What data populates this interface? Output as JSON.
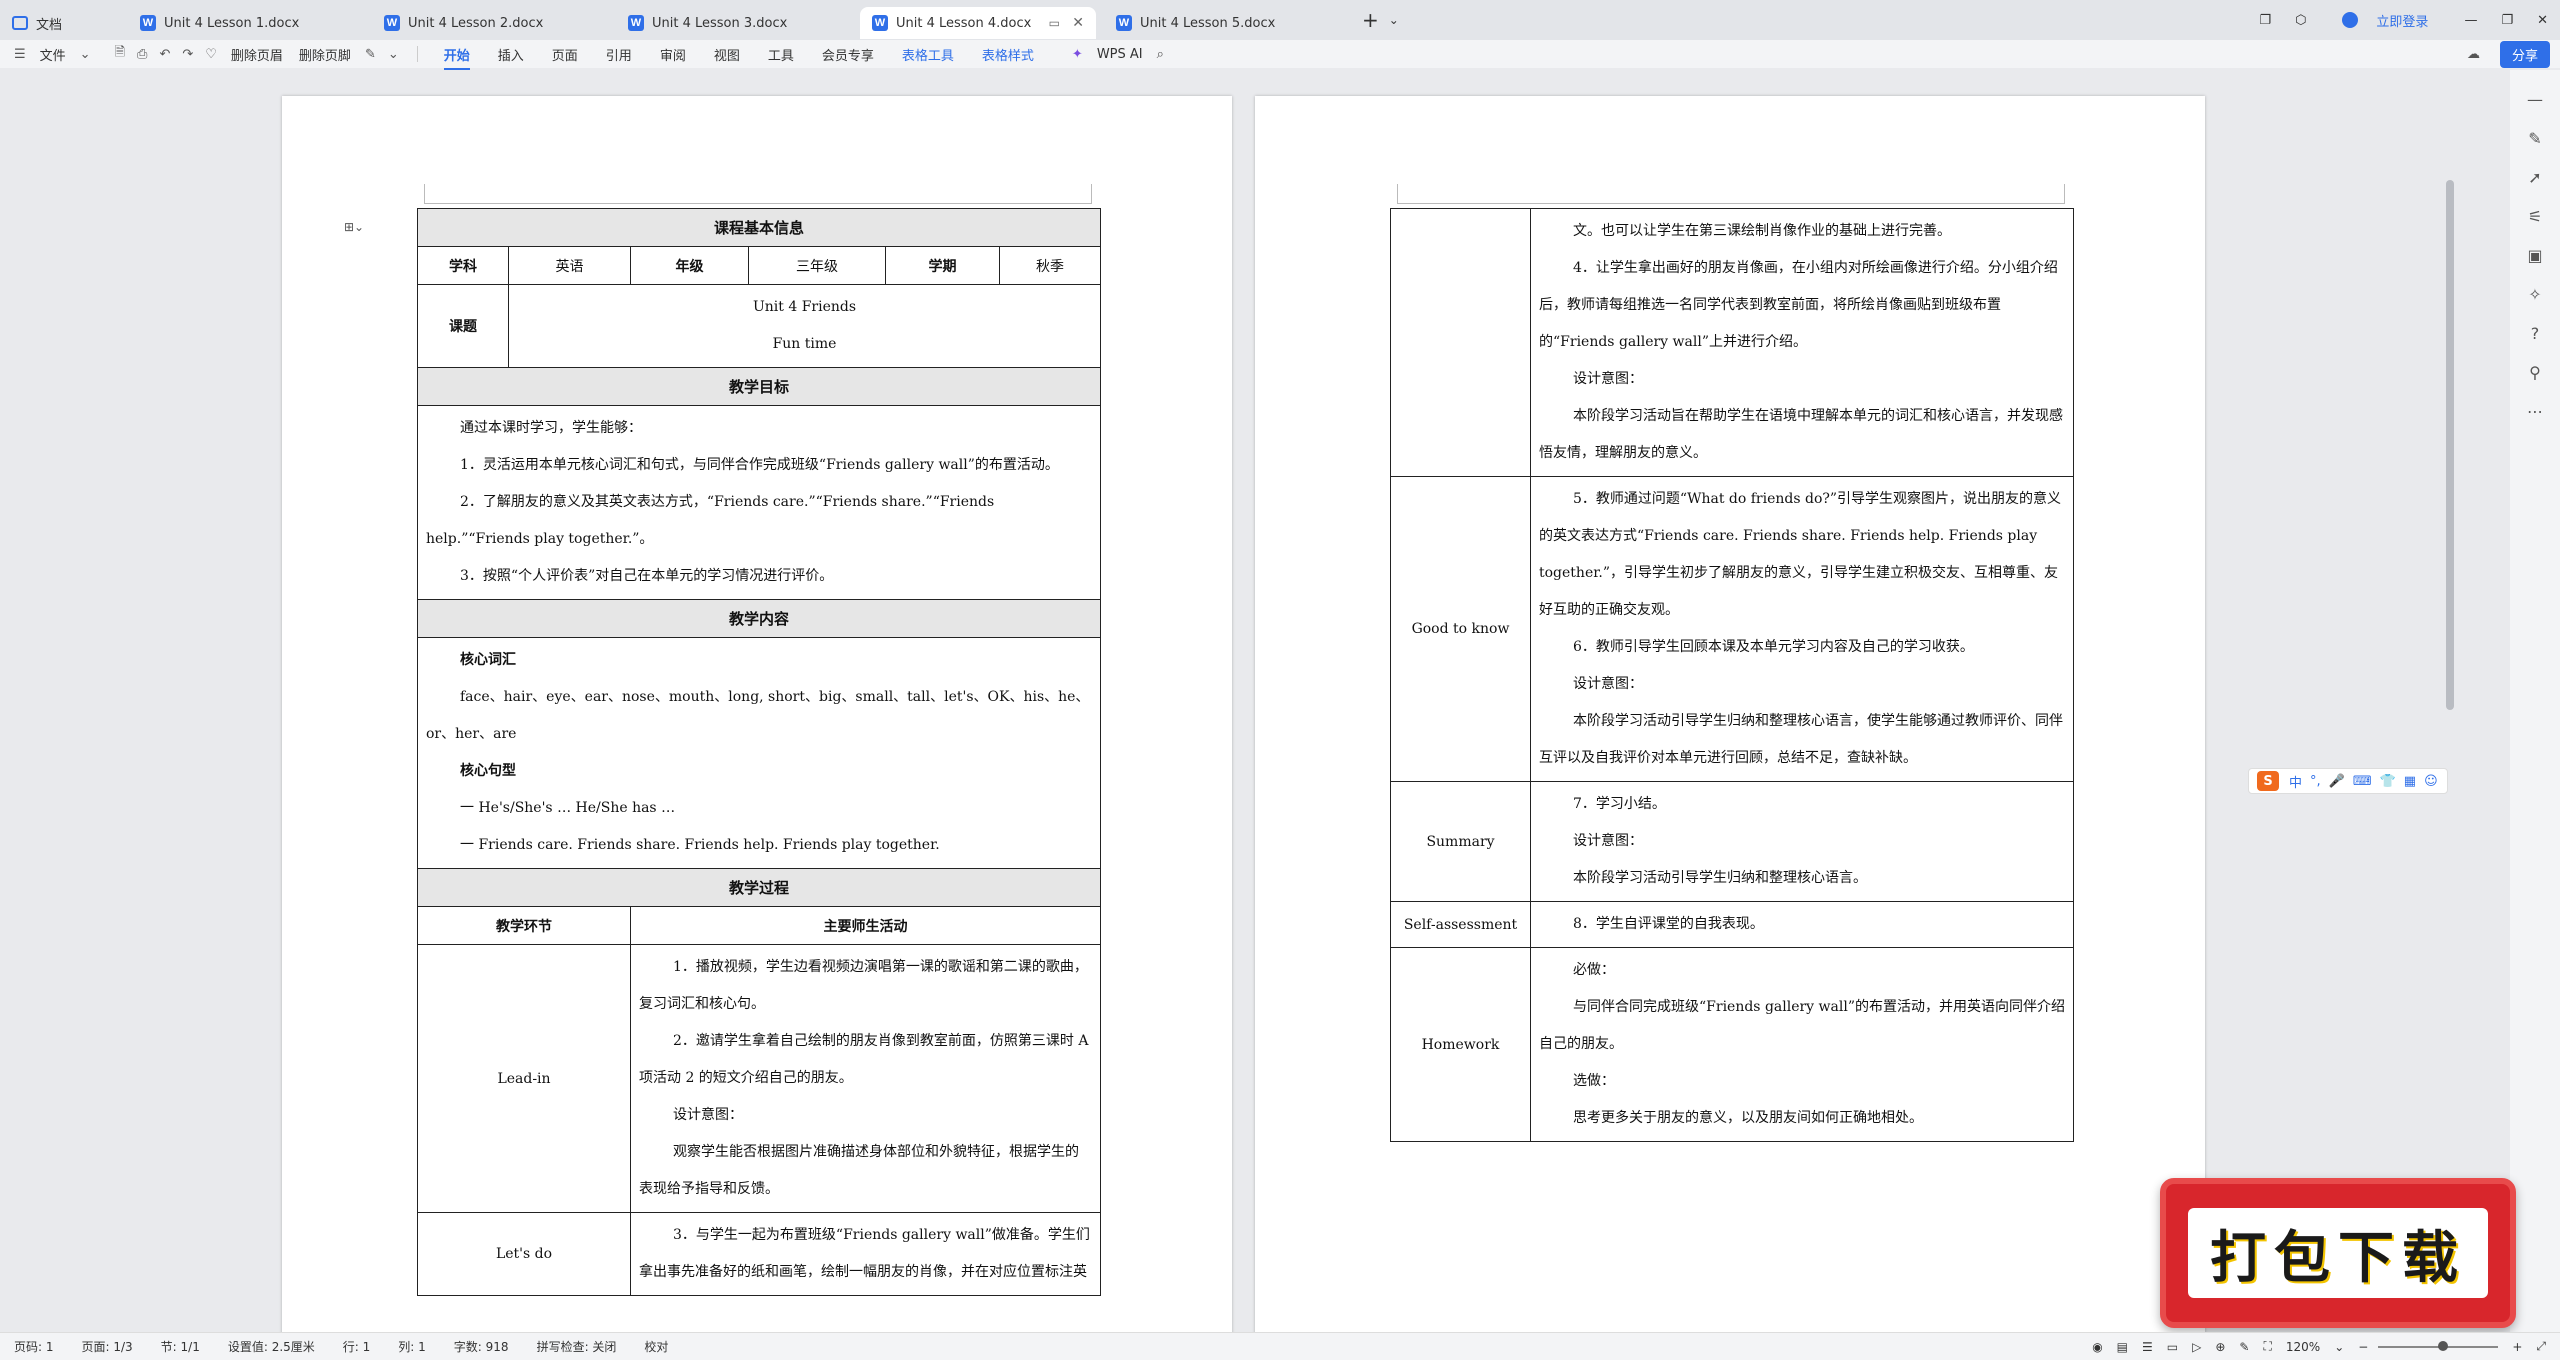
{
  "tabs": [
    {
      "label": "文档",
      "type": "home"
    },
    {
      "label": "Unit 4 Lesson 1.docx",
      "type": "doc"
    },
    {
      "label": "Unit 4 Lesson 2.docx",
      "type": "doc"
    },
    {
      "label": "Unit 4 Lesson 3.docx",
      "type": "doc"
    },
    {
      "label": "Unit 4 Lesson 4.docx",
      "type": "doc",
      "active": true
    },
    {
      "label": "Unit 4 Lesson 5.docx",
      "type": "doc"
    }
  ],
  "titlebar": {
    "login": "立即登录",
    "new_tab": "+",
    "tab_menu": "⌄"
  },
  "ribbon": {
    "file": "文件",
    "delete_header": "删除页眉",
    "delete_footer": "删除页脚",
    "menus": [
      "开始",
      "插入",
      "页面",
      "引用",
      "审阅",
      "视图",
      "工具",
      "会员专享",
      "表格工具",
      "表格样式"
    ],
    "active_menu": "开始",
    "wps_ai": "WPS AI",
    "share": "分享"
  },
  "page1": {
    "title": "课程基本信息",
    "subject_label": "学科",
    "subject": "英语",
    "grade_label": "年级",
    "grade": "三年级",
    "term_label": "学期",
    "term": "秋季",
    "topic_label": "课题",
    "topic_line1": "Unit 4 Friends",
    "topic_line2": "Fun time",
    "goals_title": "教学目标",
    "goals": [
      "通过本课时学习，学生能够：",
      "1．灵活运用本单元核心词汇和句式，与同伴合作完成班级“Friends gallery wall”的布置活动。",
      "2．了解朋友的意义及其英文表达方式，“Friends care.”“Friends share.”“Friends help.”“Friends play together.”。",
      "3．按照“个人评价表”对自己在本单元的学习情况进行评价。"
    ],
    "content_title": "教学内容",
    "vocab_title": "核心词汇",
    "vocab": "face、hair、eye、ear、nose、mouth、long, short、big、small、tall、let's、OK、his、he、or、her、are",
    "pattern_title": "核心句型",
    "patterns": [
      "一  He's/She's … He/She has …",
      "一  Friends care. Friends share. Friends help. Friends play together."
    ],
    "process_title": "教学过程",
    "col_stage": "教学环节",
    "col_activity": "主要师生活动",
    "stages": [
      {
        "name": "Lead-in",
        "paras": [
          "1．播放视频，学生边看视频边演唱第一课的歌谣和第二课的歌曲，复习词汇和核心句。",
          "2．邀请学生拿着自己绘制的朋友肖像到教室前面，仿照第三课时 A 项活动 2 的短文介绍自己的朋友。",
          "设计意图：",
          "观察学生能否根据图片准确描述身体部位和外貌特征，根据学生的表现给予指导和反馈。"
        ]
      },
      {
        "name": "Let's do",
        "paras": [
          "3．与学生一起为布置班级“Friends gallery wall”做准备。学生们拿出事先准备好的纸和画笔，绘制一幅朋友的肖像，并在对应位置标注英"
        ]
      }
    ]
  },
  "page2": {
    "stages": [
      {
        "name": "",
        "paras": [
          "文。也可以让学生在第三课绘制肖像作业的基础上进行完善。",
          "4．让学生拿出画好的朋友肖像画，在小组内对所绘画像进行介绍。分小组介绍后，教师请每组推选一名同学代表到教室前面，将所绘肖像画贴到班级布置的“Friends gallery wall”上并进行介绍。",
          "设计意图：",
          "本阶段学习活动旨在帮助学生在语境中理解本单元的词汇和核心语言，并发现感悟友情，理解朋友的意义。"
        ]
      },
      {
        "name": "Good to know",
        "paras": [
          "5．教师通过问题“What do friends do?”引导学生观察图片，说出朋友的意义的英文表达方式“Friends care. Friends share. Friends help. Friends play together.”，引导学生初步了解朋友的意义，引导学生建立积极交友、互相尊重、友好互助的正确交友观。",
          "6．教师引导学生回顾本课及本单元学习内容及自己的学习收获。",
          "设计意图：",
          "本阶段学习活动引导学生归纳和整理核心语言，使学生能够通过教师评价、同伴互评以及自我评价对本单元进行回顾，总结不足，查缺补缺。"
        ]
      },
      {
        "name": "Summary",
        "paras": [
          "7．学习小结。",
          "设计意图：",
          "本阶段学习活动引导学生归纳和整理核心语言。"
        ]
      },
      {
        "name": "Self-assessment",
        "paras": [
          "8．学生自评课堂的自我表现。"
        ]
      },
      {
        "name": "Homework",
        "paras": [
          "必做：",
          "与同伴合同完成班级“Friends gallery wall”的布置活动，并用英语向同伴介绍自己的朋友。",
          "选做：",
          "思考更多关于朋友的意义，以及朋友间如何正确地相处。"
        ]
      }
    ]
  },
  "ime": {
    "badge": "S",
    "items": [
      "中",
      "°,",
      "🎤",
      "⌨",
      "👕",
      "▦",
      "☺"
    ]
  },
  "download_badge": "打包下载",
  "statusbar": {
    "page_no": "页码: 1",
    "pages": "页面: 1/3",
    "section": "节: 1/1",
    "setting": "设置值: 2.5厘米",
    "row": "行: 1",
    "col": "列: 1",
    "word_count": "字数: 918",
    "spell": "拼写检查: 关闭",
    "proof": "校对",
    "zoom": "120%"
  }
}
